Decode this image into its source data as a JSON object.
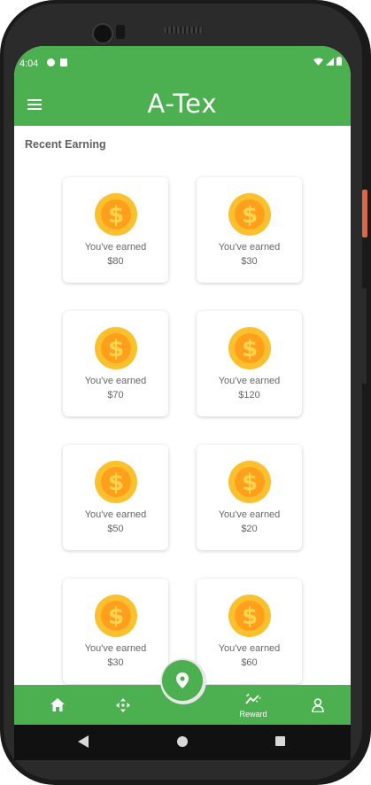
{
  "status_bar": {
    "time": "4:04"
  },
  "app_bar": {
    "logo": "A-Tex",
    "menu_icon": "hamburger-menu-icon"
  },
  "section": {
    "title": "Recent Earning"
  },
  "cards": [
    {
      "label": "You've earned",
      "amount": "$80"
    },
    {
      "label": "You've earned",
      "amount": "$30"
    },
    {
      "label": "You've earned",
      "amount": "$70"
    },
    {
      "label": "You've earned",
      "amount": "$120"
    },
    {
      "label": "You've earned",
      "amount": "$50"
    },
    {
      "label": "You've earned",
      "amount": "$20"
    },
    {
      "label": "You've earned",
      "amount": "$30"
    },
    {
      "label": "You've earned",
      "amount": "$60"
    }
  ],
  "bottom_nav": {
    "items": [
      {
        "icon": "home-icon",
        "label": ""
      },
      {
        "icon": "move-arrows-icon",
        "label": ""
      },
      {
        "icon": "location-pin-icon",
        "label": ""
      },
      {
        "icon": "reward-icon",
        "label": "Reward"
      },
      {
        "icon": "profile-icon",
        "label": ""
      }
    ]
  },
  "colors": {
    "primary": "#4caf50",
    "coin_outer": "#fbc02d",
    "coin_inner": "#ff9f1c",
    "text_muted": "#666666"
  }
}
